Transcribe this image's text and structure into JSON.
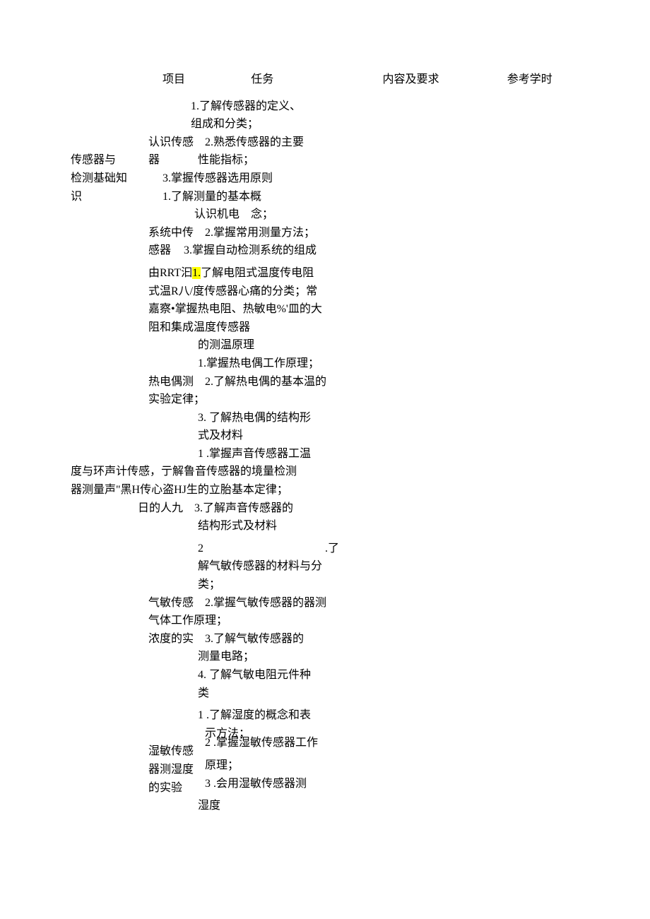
{
  "header": {
    "project": "项目",
    "task": "任务",
    "content": "内容及要求",
    "hours": "参考学时"
  },
  "s1": {
    "project_line1": "传感器与",
    "project_line2": "检测基础知",
    "project_line3": "识",
    "t1a": "1.了解传感器的定义、",
    "t1b": "组成和分类；",
    "t1_task": "认识传感",
    "t1c": "2.熟悉传感器的主要",
    "t1_task2": "器",
    "t1d": "性能指标；",
    "t1e": "3.掌握传感器选用原则",
    "t1f": "1.了解测量的基本概",
    "t2_task": "认识机电",
    "t1g": "念；",
    "t2a": "系统中传",
    "t2b": "2.掌握常用测量方法；",
    "t2c": "感器",
    "t2d": "3.掌握自动检测系统的组成"
  },
  "s2": {
    "l1a": "由RRT汩",
    "hl": "1.",
    "l1b": "了解电阻式温度传电阻",
    "l2": "式温R八/度传感器心痛的分类；常",
    "l3": "嘉察•掌握热电阻、热敏电%'皿的大",
    "l4": "阻和集成温度传感器",
    "l5": "的测温原理",
    "l6": "1.掌握热电偶工作原理；",
    "l7a": "热电偶测",
    "l7b": "2.了解热电偶的基本温的",
    "l8": "实验定律；",
    "l9": "3.  了解热电偶的结构形",
    "l10": "式及材料",
    "l11": "1 .掌握声音传感器工温",
    "l12": "度与环声计传感，亍解鲁音传感器的境量检测",
    "l13": "器测量声\"黑H传心盗HJ生的立胎基本定律；",
    "l14": "日的人九",
    "l14b": "3.了解声音传感器的",
    "l15": "结构形式及材料"
  },
  "s3": {
    "l1a": "2",
    "l1b": ".了",
    "l2": "解气敏传感器的材料与分",
    "l3": "类；",
    "l4a": "气敏传感",
    "l4b": "2.掌握气敏传感器的器测",
    "l5": "气体工作原理；",
    "l6a": "浓度的实",
    "l6b": "3.了解气敏传感器的",
    "l7": "测量电路；",
    "l8": "4.  了解气敏电阻元件种",
    "l9": "类"
  },
  "s4": {
    "l1": "1 .了解湿度的概念和表",
    "l2": "示方法；",
    "task1": "湿敏传感",
    "l3": "2 .掌握湿敏传感器工作",
    "task2": "器测湿度",
    "l4": "原理；",
    "task3": "的实验",
    "l5": "3 .会用湿敏传感器测",
    "l6": "湿度"
  }
}
